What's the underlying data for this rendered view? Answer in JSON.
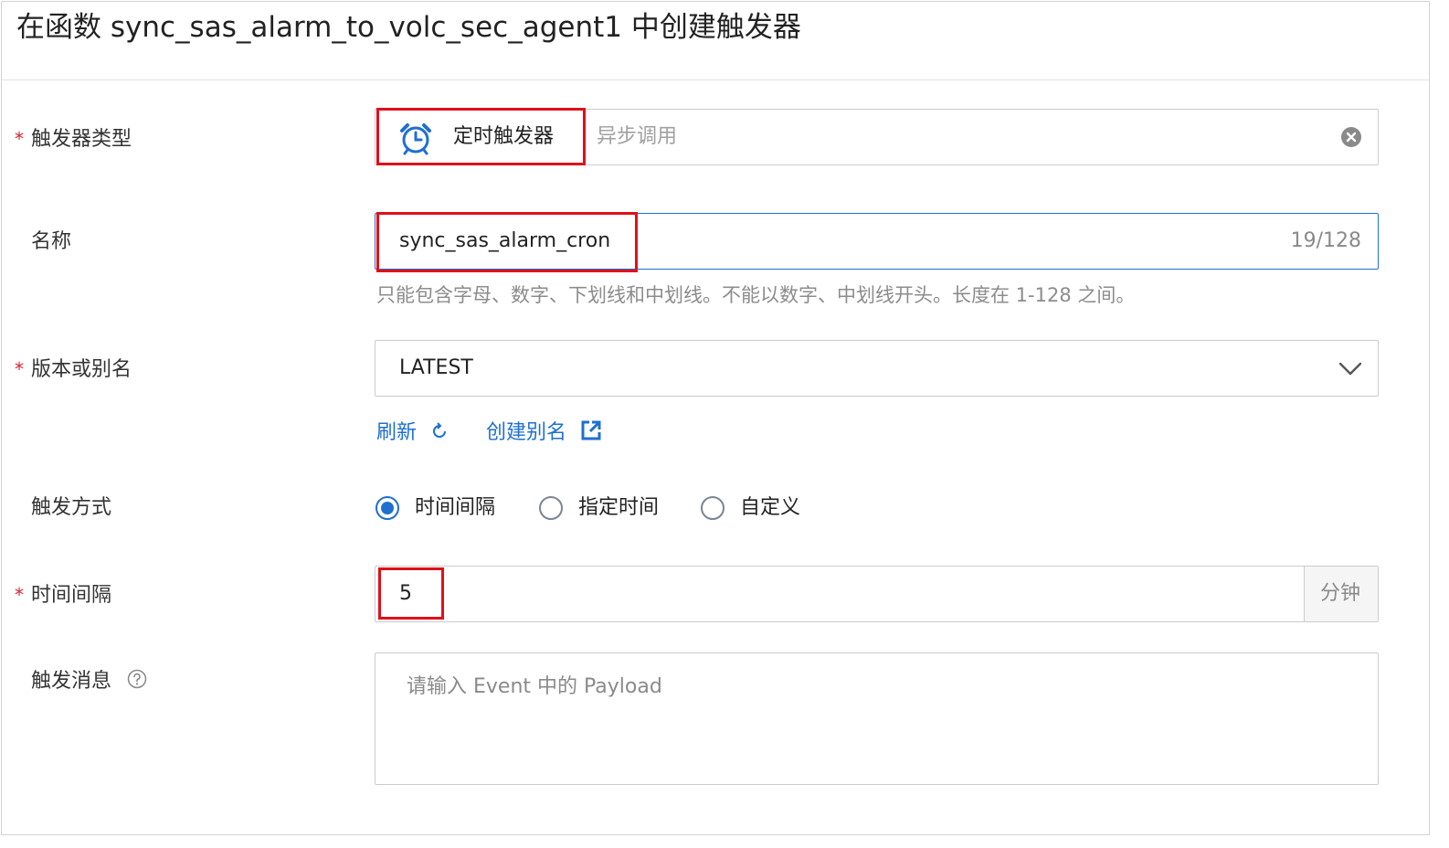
{
  "header": {
    "title": "在函数 sync_sas_alarm_to_volc_sec_agent1 中创建触发器"
  },
  "form": {
    "trigger_type": {
      "label": "触发器类型",
      "required": true,
      "selected": "定时触发器",
      "option_icon": "alarm-clock-icon",
      "placeholder": "异步调用",
      "clear_icon": "clear-circle-icon"
    },
    "name": {
      "label": "名称",
      "value": "sync_sas_alarm_cron",
      "counter": "19/128",
      "hint": "只能包含字母、数字、下划线和中划线。不能以数字、中划线开头。长度在 1-128 之间。"
    },
    "version": {
      "label": "版本或别名",
      "required": true,
      "value": "LATEST",
      "refresh_label": "刷新",
      "create_alias_label": "创建别名"
    },
    "trigger_mode": {
      "label": "触发方式",
      "options": [
        "时间间隔",
        "指定时间",
        "自定义"
      ],
      "selected": "时间间隔"
    },
    "interval": {
      "label": "时间间隔",
      "required": true,
      "value": "5",
      "unit": "分钟"
    },
    "message": {
      "label": "触发消息",
      "placeholder": "请输入 Event 中的 Payload",
      "help_icon": "question-circle-icon"
    }
  },
  "colors": {
    "accent": "#1f6fd1",
    "required": "#d9232d",
    "highlight": "#e0101a"
  }
}
